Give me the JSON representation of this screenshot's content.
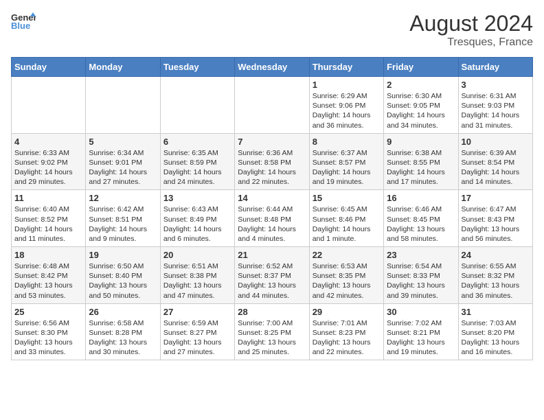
{
  "header": {
    "logo_line1": "General",
    "logo_line2": "Blue",
    "month_year": "August 2024",
    "location": "Tresques, France"
  },
  "weekdays": [
    "Sunday",
    "Monday",
    "Tuesday",
    "Wednesday",
    "Thursday",
    "Friday",
    "Saturday"
  ],
  "weeks": [
    [
      {
        "day": "",
        "info": ""
      },
      {
        "day": "",
        "info": ""
      },
      {
        "day": "",
        "info": ""
      },
      {
        "day": "",
        "info": ""
      },
      {
        "day": "1",
        "info": "Sunrise: 6:29 AM\nSunset: 9:06 PM\nDaylight: 14 hours and 36 minutes."
      },
      {
        "day": "2",
        "info": "Sunrise: 6:30 AM\nSunset: 9:05 PM\nDaylight: 14 hours and 34 minutes."
      },
      {
        "day": "3",
        "info": "Sunrise: 6:31 AM\nSunset: 9:03 PM\nDaylight: 14 hours and 31 minutes."
      }
    ],
    [
      {
        "day": "4",
        "info": "Sunrise: 6:33 AM\nSunset: 9:02 PM\nDaylight: 14 hours and 29 minutes."
      },
      {
        "day": "5",
        "info": "Sunrise: 6:34 AM\nSunset: 9:01 PM\nDaylight: 14 hours and 27 minutes."
      },
      {
        "day": "6",
        "info": "Sunrise: 6:35 AM\nSunset: 8:59 PM\nDaylight: 14 hours and 24 minutes."
      },
      {
        "day": "7",
        "info": "Sunrise: 6:36 AM\nSunset: 8:58 PM\nDaylight: 14 hours and 22 minutes."
      },
      {
        "day": "8",
        "info": "Sunrise: 6:37 AM\nSunset: 8:57 PM\nDaylight: 14 hours and 19 minutes."
      },
      {
        "day": "9",
        "info": "Sunrise: 6:38 AM\nSunset: 8:55 PM\nDaylight: 14 hours and 17 minutes."
      },
      {
        "day": "10",
        "info": "Sunrise: 6:39 AM\nSunset: 8:54 PM\nDaylight: 14 hours and 14 minutes."
      }
    ],
    [
      {
        "day": "11",
        "info": "Sunrise: 6:40 AM\nSunset: 8:52 PM\nDaylight: 14 hours and 11 minutes."
      },
      {
        "day": "12",
        "info": "Sunrise: 6:42 AM\nSunset: 8:51 PM\nDaylight: 14 hours and 9 minutes."
      },
      {
        "day": "13",
        "info": "Sunrise: 6:43 AM\nSunset: 8:49 PM\nDaylight: 14 hours and 6 minutes."
      },
      {
        "day": "14",
        "info": "Sunrise: 6:44 AM\nSunset: 8:48 PM\nDaylight: 14 hours and 4 minutes."
      },
      {
        "day": "15",
        "info": "Sunrise: 6:45 AM\nSunset: 8:46 PM\nDaylight: 14 hours and 1 minute."
      },
      {
        "day": "16",
        "info": "Sunrise: 6:46 AM\nSunset: 8:45 PM\nDaylight: 13 hours and 58 minutes."
      },
      {
        "day": "17",
        "info": "Sunrise: 6:47 AM\nSunset: 8:43 PM\nDaylight: 13 hours and 56 minutes."
      }
    ],
    [
      {
        "day": "18",
        "info": "Sunrise: 6:48 AM\nSunset: 8:42 PM\nDaylight: 13 hours and 53 minutes."
      },
      {
        "day": "19",
        "info": "Sunrise: 6:50 AM\nSunset: 8:40 PM\nDaylight: 13 hours and 50 minutes."
      },
      {
        "day": "20",
        "info": "Sunrise: 6:51 AM\nSunset: 8:38 PM\nDaylight: 13 hours and 47 minutes."
      },
      {
        "day": "21",
        "info": "Sunrise: 6:52 AM\nSunset: 8:37 PM\nDaylight: 13 hours and 44 minutes."
      },
      {
        "day": "22",
        "info": "Sunrise: 6:53 AM\nSunset: 8:35 PM\nDaylight: 13 hours and 42 minutes."
      },
      {
        "day": "23",
        "info": "Sunrise: 6:54 AM\nSunset: 8:33 PM\nDaylight: 13 hours and 39 minutes."
      },
      {
        "day": "24",
        "info": "Sunrise: 6:55 AM\nSunset: 8:32 PM\nDaylight: 13 hours and 36 minutes."
      }
    ],
    [
      {
        "day": "25",
        "info": "Sunrise: 6:56 AM\nSunset: 8:30 PM\nDaylight: 13 hours and 33 minutes."
      },
      {
        "day": "26",
        "info": "Sunrise: 6:58 AM\nSunset: 8:28 PM\nDaylight: 13 hours and 30 minutes."
      },
      {
        "day": "27",
        "info": "Sunrise: 6:59 AM\nSunset: 8:27 PM\nDaylight: 13 hours and 27 minutes."
      },
      {
        "day": "28",
        "info": "Sunrise: 7:00 AM\nSunset: 8:25 PM\nDaylight: 13 hours and 25 minutes."
      },
      {
        "day": "29",
        "info": "Sunrise: 7:01 AM\nSunset: 8:23 PM\nDaylight: 13 hours and 22 minutes."
      },
      {
        "day": "30",
        "info": "Sunrise: 7:02 AM\nSunset: 8:21 PM\nDaylight: 13 hours and 19 minutes."
      },
      {
        "day": "31",
        "info": "Sunrise: 7:03 AM\nSunset: 8:20 PM\nDaylight: 13 hours and 16 minutes."
      }
    ]
  ]
}
